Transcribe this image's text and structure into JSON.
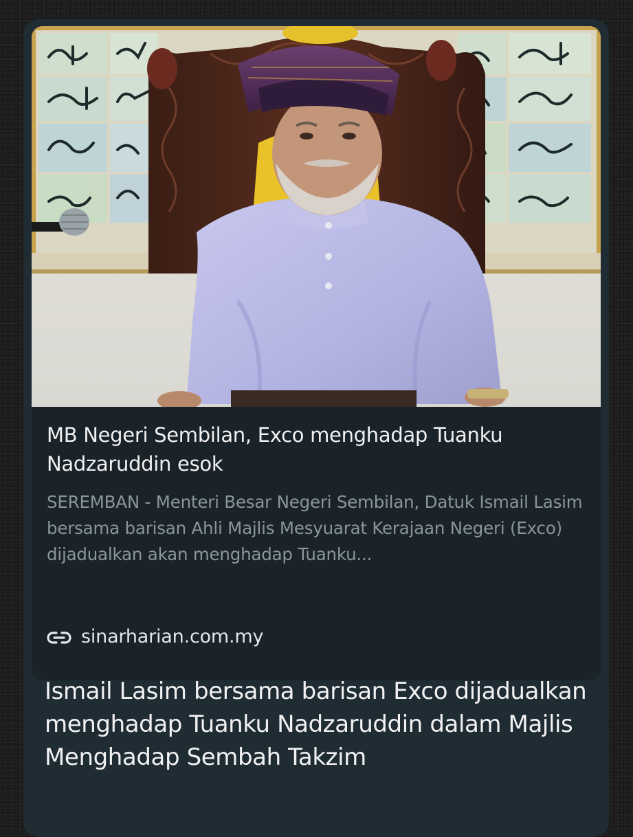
{
  "link_preview": {
    "image_alt": "",
    "title": "MB Negeri Sembilan, Exco menghadap Tuanku Nadzaruddin esok",
    "description": "SEREMBAN - Menteri Besar Negeri Sembilan, Datuk Ismail Lasim bersama barisan Ahli Majlis Mesyuarat Kerajaan Negeri (Exco) dijadualkan akan menghadap Tuanku...",
    "domain": "sinarharian.com.my",
    "domain_icon": "link-icon"
  },
  "message": {
    "text": "Ismail Lasim bersama barisan Exco dijadualkan menghadap Tuanku Nadzaruddin dalam Majlis Menghadap Sembah Takzim"
  },
  "colors": {
    "bubble_bg": "#1f2c34",
    "card_bg": "#1a2329",
    "title_text": "#f1f1f2",
    "description_text": "#8a959c"
  }
}
